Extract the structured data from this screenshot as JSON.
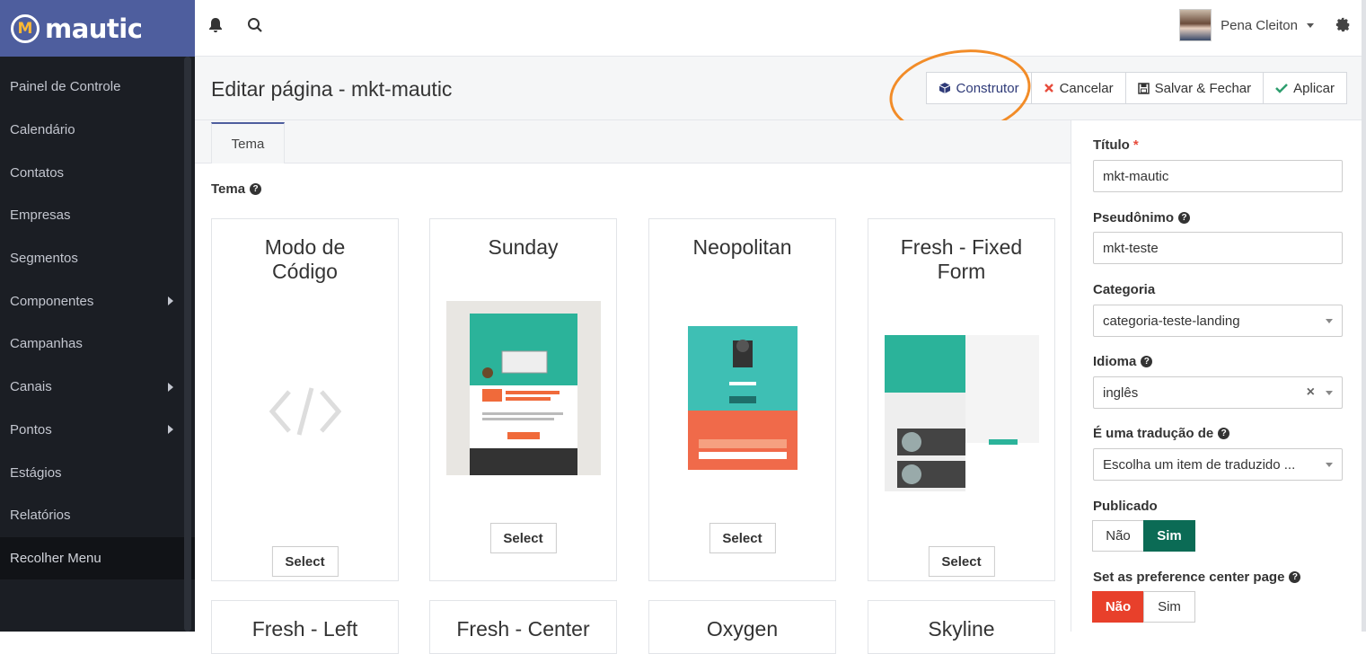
{
  "app": {
    "name": "mautic",
    "brand_color": "#4e5e9e"
  },
  "sidebar": {
    "items": [
      {
        "label": "Painel de Controle"
      },
      {
        "label": "Calendário"
      },
      {
        "label": "Contatos"
      },
      {
        "label": "Empresas"
      },
      {
        "label": "Segmentos"
      },
      {
        "label": "Componentes"
      },
      {
        "label": "Campanhas"
      },
      {
        "label": "Canais"
      },
      {
        "label": "Pontos"
      },
      {
        "label": "Estágios"
      },
      {
        "label": "Relatórios"
      },
      {
        "label": "Recolher Menu"
      }
    ]
  },
  "topbar": {
    "user_name": "Pena Cleiton"
  },
  "header": {
    "title": "Editar página - mkt-mautic",
    "buttons": {
      "builder": "Construtor",
      "cancel": "Cancelar",
      "save_close": "Salvar & Fechar",
      "apply": "Aplicar"
    }
  },
  "tabs": [
    {
      "label": "Tema"
    }
  ],
  "theme_section": {
    "label": "Tema",
    "select_label": "Select",
    "themes": [
      {
        "name": "Modo de Código"
      },
      {
        "name": "Sunday"
      },
      {
        "name": "Neopolitan"
      },
      {
        "name": "Fresh - Fixed Form"
      },
      {
        "name": "Fresh - Left"
      },
      {
        "name": "Fresh - Center"
      },
      {
        "name": "Oxygen"
      },
      {
        "name": "Skyline"
      }
    ]
  },
  "form": {
    "title_label": "Título",
    "title_value": "mkt-mautic",
    "alias_label": "Pseudônimo",
    "alias_value": "mkt-teste",
    "category_label": "Categoria",
    "category_value": "categoria-teste-landing",
    "language_label": "Idioma",
    "language_value": "inglês",
    "translation_label": "É uma tradução de",
    "translation_value": "Escolha um item de traduzido ...",
    "published_label": "Publicado",
    "published_no": "Não",
    "published_yes": "Sim",
    "preference_label": "Set as preference center page",
    "preference_no": "Não",
    "preference_yes": "Sim"
  },
  "colors": {
    "published_on": "#0b6b55",
    "preference_on": "#e8402b",
    "accent": "#f28c28"
  }
}
